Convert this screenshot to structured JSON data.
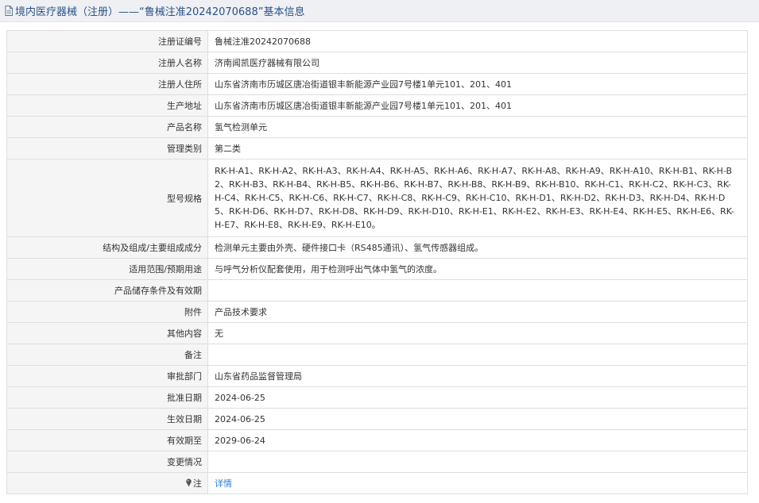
{
  "header": {
    "title": "境内医疗器械（注册）——“鲁械注准20242070688”基本信息",
    "icon": "document-icon"
  },
  "rows": [
    {
      "label": "注册证编号",
      "value": "鲁械注准20242070688"
    },
    {
      "label": "注册人名称",
      "value": "济南闻凯医疗器械有限公司"
    },
    {
      "label": "注册人住所",
      "value": "山东省济南市历城区唐冶街道银丰新能源产业园7号楼1单元101、201、401"
    },
    {
      "label": "生产地址",
      "value": "山东省济南市历城区唐冶街道银丰新能源产业园7号楼1单元101、201、401"
    },
    {
      "label": "产品名称",
      "value": "氢气检测单元"
    },
    {
      "label": "管理类别",
      "value": "第二类"
    },
    {
      "label": "型号规格",
      "value": "RK-H-A1、RK-H-A2、RK-H-A3、RK-H-A4、RK-H-A5、RK-H-A6、RK-H-A7、RK-H-A8、RK-H-A9、RK-H-A10、RK-H-B1、RK-H-B2、RK-H-B3、RK-H-B4、RK-H-B5、RK-H-B6、RK-H-B7、RK-H-B8、RK-H-B9、RK-H-B10、RK-H-C1、RK-H-C2、RK-H-C3、RK-H-C4、RK-H-C5、RK-H-C6、RK-H-C7、RK-H-C8、RK-H-C9、RK-H-C10、RK-H-D1、RK-H-D2、RK-H-D3、RK-H-D4、RK-H-D5、RK-H-D6、RK-H-D7、RK-H-D8、RK-H-D9、RK-H-D10、RK-H-E1、RK-H-E2、RK-H-E3、RK-H-E4、RK-H-E5、RK-H-E6、RK-H-E7、RK-H-E8、RK-H-E9、RK-H-E10。"
    },
    {
      "label": "结构及组成/主要组成成分",
      "value": "检测单元主要由外壳、硬件接口卡（RS485通讯）、氢气传感器组成。"
    },
    {
      "label": "适用范围/预期用途",
      "value": "与呼气分析仪配套使用，用于检测呼出气体中氢气的浓度。"
    },
    {
      "label": "产品储存条件及有效期",
      "value": ""
    },
    {
      "label": "附件",
      "value": "产品技术要求"
    },
    {
      "label": "其他内容",
      "value": "无"
    },
    {
      "label": "备注",
      "value": ""
    },
    {
      "label": "审批部门",
      "value": "山东省药品监督管理局"
    },
    {
      "label": "批准日期",
      "value": "2024-06-25"
    },
    {
      "label": "生效日期",
      "value": "2024-06-25"
    },
    {
      "label": "有效期至",
      "value": "2029-06-24"
    },
    {
      "label": "变更情况",
      "value": ""
    }
  ],
  "note": {
    "label": "注",
    "icon": "pin-icon",
    "link_text": "详情",
    "link_color": "#2e7bd6"
  }
}
